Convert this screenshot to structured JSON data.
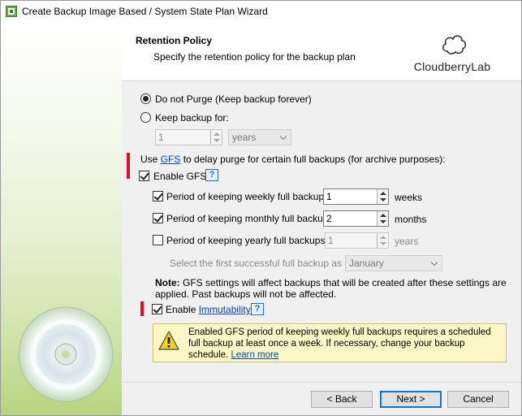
{
  "window": {
    "title": "Create Backup Image Based / System State Plan Wizard"
  },
  "header": {
    "title": "Retention Policy",
    "subtitle": "Specify the retention policy for the backup plan",
    "logo_text": "CloudberryLab"
  },
  "retention": {
    "do_not_purge_label": "Do not Purge (Keep backup forever)",
    "keep_backup_label": "Keep backup for:",
    "keep_value": "1",
    "keep_unit": "years",
    "selected": "do_not_purge"
  },
  "gfs": {
    "intro_prefix": "Use",
    "intro_link": "GFS",
    "intro_suffix": "to delay purge for certain full backups (for archive purposes):",
    "enable_label": "Enable GFS",
    "enabled": true,
    "weekly": {
      "label": "Period of keeping weekly full backups:",
      "value": "1",
      "unit": "weeks",
      "checked": true
    },
    "monthly": {
      "label": "Period of keeping monthly full backups:",
      "value": "2",
      "unit": "months",
      "checked": true
    },
    "yearly": {
      "label": "Period of keeping yearly full backups:",
      "value": "1",
      "unit": "years",
      "checked": false
    },
    "first_backup_label": "Select the first successful full backup as of:",
    "first_backup_value": "January",
    "note_bold": "Note:",
    "note_text": "GFS settings will affect backups that will be created after these settings are applied. Past backups will not be affected."
  },
  "immutability": {
    "prefix": "Enable",
    "link": "Immutability",
    "checked": true
  },
  "warning": {
    "text": "Enabled GFS period of keeping weekly full backups requires a scheduled full backup at least once a week. If necessary, change your backup schedule.",
    "link": "Learn more"
  },
  "footer": {
    "back_label": "< Back",
    "next_label": "Next >",
    "cancel_label": "Cancel"
  },
  "colors": {
    "sidebar_gradient_end": "#b7d37f",
    "content_bg": "#f0f0f0",
    "red_marker": "#e01020",
    "link": "#0645ad",
    "warning_bg": "#fdf7c5"
  },
  "icons": [
    "app-icon",
    "cd-disc-icon",
    "cloud-logo-icon",
    "help-icon",
    "warning-icon"
  ]
}
